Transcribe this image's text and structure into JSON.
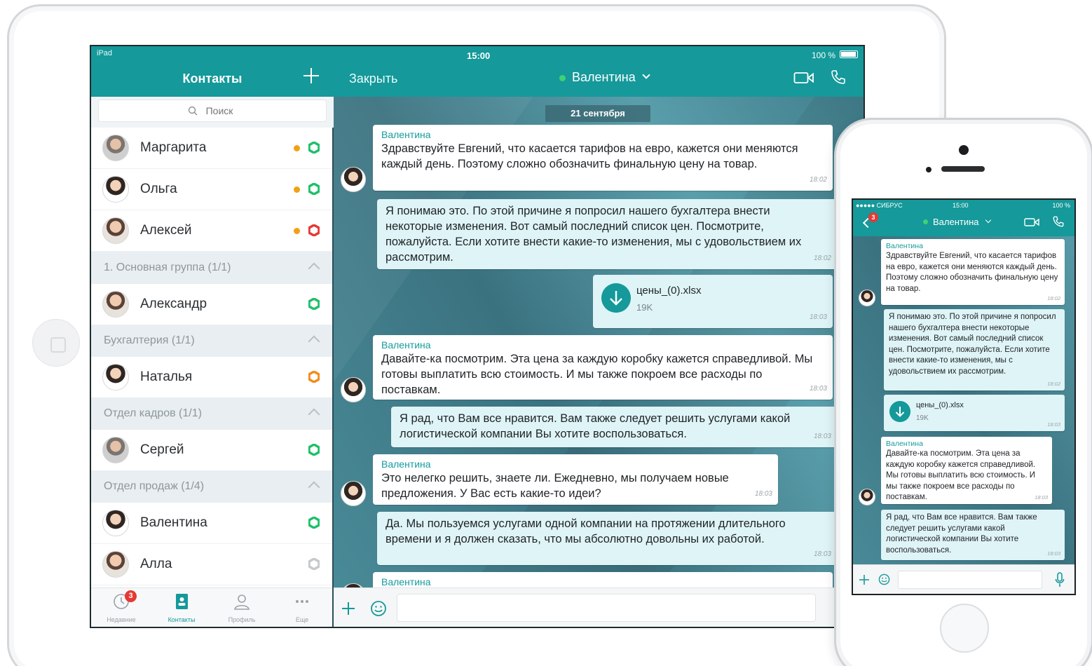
{
  "colors": {
    "teal": "#15999a",
    "online": "#3fd175",
    "away": "#f2a014",
    "busy": "#e53935",
    "bubble_out": "#dff4f6"
  },
  "ipad": {
    "status": {
      "carrier": "iPad",
      "time": "15:00",
      "battery": "100 %"
    },
    "contacts": {
      "title": "Контакты",
      "search_placeholder": "Поиск",
      "items": [
        {
          "name": "Маргарита",
          "status": "away+online"
        },
        {
          "name": "Ольга",
          "status": "away+online"
        },
        {
          "name": "Алексей",
          "status": "away+busy"
        }
      ],
      "groups": [
        {
          "label": "1. Основная группа (1/1)",
          "members": [
            {
              "name": "Александр",
              "status": "online"
            }
          ]
        },
        {
          "label": "Бухгалтерия (1/1)",
          "members": [
            {
              "name": "Наталья",
              "status": "dnd-orange"
            }
          ]
        },
        {
          "label": "Отдел кадров (1/1)",
          "members": [
            {
              "name": "Сергей",
              "status": "online"
            }
          ]
        },
        {
          "label": "Отдел продаж (1/4)",
          "members": [
            {
              "name": "Валентина",
              "status": "online"
            },
            {
              "name": "Алла",
              "status": "offline"
            }
          ]
        }
      ]
    },
    "tabs": [
      {
        "label": "Недавние",
        "icon": "clock-icon",
        "badge": "3"
      },
      {
        "label": "Контакты",
        "icon": "contacts-icon",
        "active": true
      },
      {
        "label": "Профиль",
        "icon": "profile-icon"
      },
      {
        "label": "Еще",
        "icon": "more-icon"
      }
    ],
    "chat": {
      "close_label": "Закрыть",
      "contact_name": "Валентина",
      "date": "21 сентября",
      "messages": [
        {
          "sender": "Валентина",
          "text": "Здравствуйте Евгений, что касается тарифов на евро, кажется они меняются каждый день. Поэтому сложно обозначить финальную цену на товар.",
          "time": "18:02"
        },
        {
          "text": "Я понимаю это. По этой причине я попросил нашего бухгалтера внести некоторые изменения. Вот самый последний список цен. Посмотрите, пожалуйста. Если хотите внести какие-то изменения, мы с удовольствием их рассмотрим.",
          "time": "18:02"
        },
        {
          "file": "цены_(0).xlsx",
          "size": "19K",
          "time": "18:03"
        },
        {
          "sender": "Валентина",
          "text": "Давайте-ка посмотрим. Эта цена за каждую коробку кажется справедливой. Мы готовы выплатить всю стоимость. И мы также покроем все расходы по поставкам.",
          "time": "18:03"
        },
        {
          "text": "Я рад, что Вам все нравится. Вам также следует решить услугами какой логистической компании Вы хотите воспользоваться.",
          "time": "18:03"
        },
        {
          "sender": "Валентина",
          "text": "Это нелегко решить, знаете ли. Ежедневно, мы получаем новые предложения. У Вас есть какие-то идеи?",
          "time": "18:03"
        },
        {
          "text": "Да. Мы пользуемся услугами одной компании на протяжении длительного времени и я должен сказать, что мы абсолютно довольны их работой.",
          "time": "18:03"
        },
        {
          "sender": "Валентина"
        }
      ]
    }
  },
  "iphone": {
    "status": {
      "carrier": "●●●●● СИБРУС",
      "time": "15:00",
      "battery": "100 %"
    },
    "back_badge": "3",
    "contact_name": "Валентина",
    "messages": [
      {
        "sender": "Валентина",
        "text": "Здравствуйте Евгений, что касается тарифов на евро, кажется они меняются каждый день. Поэтому сложно обозначить финальную цену на товар.",
        "time": "18:02"
      },
      {
        "text": "Я понимаю это. По этой причине я попросил нашего бухгалтера внести некоторые изменения. Вот самый последний список цен. Посмотрите, пожалуйста. Если хотите внести какие-то изменения, мы с удовольствием их рассмотрим.",
        "time": "18:02"
      },
      {
        "file": "цены_(0).xlsx",
        "size": "19K",
        "time": "18:03"
      },
      {
        "sender": "Валентина",
        "text": "Давайте-ка посмотрим. Эта цена за каждую коробку кажется справедливой. Мы готовы выплатить всю стоимость. И мы также покроем все расходы по поставкам.",
        "time": "18:03"
      },
      {
        "text": "Я рад, что Вам все нравится. Вам также следует решить услугами какой логистической компании Вы хотите воспользоваться.",
        "time": "18:03"
      }
    ]
  }
}
